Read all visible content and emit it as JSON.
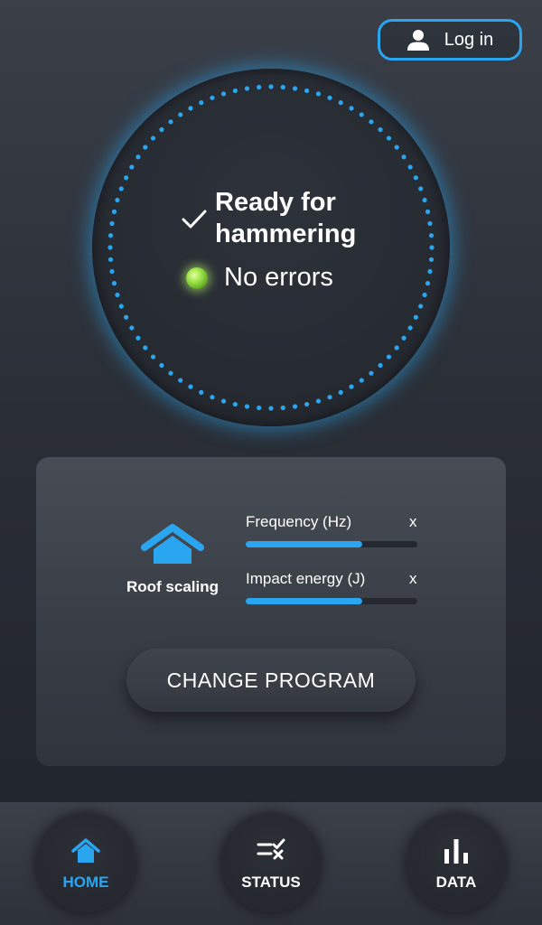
{
  "header": {
    "login_label": "Log in",
    "user_icon": "user-icon"
  },
  "status": {
    "ready_text": "Ready for hammering",
    "errors_text": "No errors",
    "led_color": "#8fdc3f",
    "check_icon": "check-icon"
  },
  "program": {
    "name": "Roof scaling",
    "icon": "house-icon",
    "params": [
      {
        "label": "Frequency (Hz)",
        "value": "x",
        "level": 0.68
      },
      {
        "label": "Impact energy (J)",
        "value": "x",
        "level": 0.68
      }
    ],
    "change_label": "CHANGE PROGRAM"
  },
  "nav": {
    "items": [
      {
        "label": "HOME",
        "icon": "home-icon",
        "active": true
      },
      {
        "label": "STATUS",
        "icon": "checklist-icon",
        "active": false
      },
      {
        "label": "DATA",
        "icon": "bar-chart-icon",
        "active": false
      }
    ]
  },
  "colors": {
    "accent": "#2aa6f0",
    "background": "#2a2e35",
    "card": "#3f444c"
  }
}
